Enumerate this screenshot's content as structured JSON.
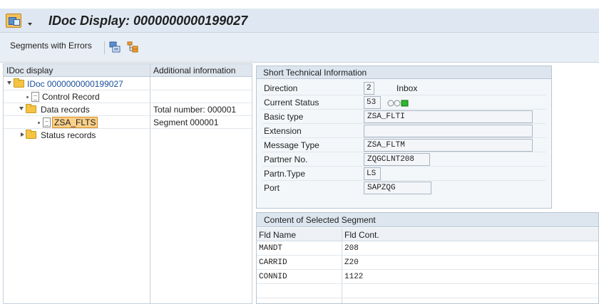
{
  "window": {
    "title": "IDoc Display: 0000000000199027"
  },
  "toolbar": {
    "segments_with_errors_label": "Segments with Errors",
    "icon1": "structure-display-icon",
    "icon2": "hierarchy-icon"
  },
  "tree": {
    "col_headers": [
      "IDoc display",
      "Additional information"
    ],
    "items": [
      {
        "label": "IDoc 0000000000199027",
        "info": "",
        "icon": "folder-open-icon",
        "expanded": true
      },
      {
        "label": "Control Record",
        "info": "",
        "icon": "document-icon"
      },
      {
        "label": "Data records",
        "info": "Total number: 000001",
        "icon": "folder-open-icon",
        "expanded": true
      },
      {
        "label": "ZSA_FLTS",
        "info": "Segment 000001",
        "icon": "document-icon",
        "selected": true
      },
      {
        "label": "Status records",
        "info": "",
        "icon": "folder-closed-icon",
        "expanded": false
      }
    ]
  },
  "technical_info": {
    "title": "Short Technical Information",
    "fields": [
      {
        "label": "Direction",
        "value": "2",
        "extra": "Inbox"
      },
      {
        "label": "Current Status",
        "value": "53",
        "status_color": "green"
      },
      {
        "label": "Basic type",
        "value": "ZSA_FLTI"
      },
      {
        "label": "Extension",
        "value": ""
      },
      {
        "label": "Message Type",
        "value": "ZSA_FLTM"
      },
      {
        "label": "Partner No.",
        "value": "ZQGCLNT208"
      },
      {
        "label": "Partn.Type",
        "value": "LS"
      },
      {
        "label": "Port",
        "value": "SAPZQG"
      }
    ]
  },
  "segment_content": {
    "title": "Content of Selected Segment",
    "col_headers": [
      "Fld Name",
      "Fld Cont."
    ],
    "rows": [
      {
        "name": "MANDT",
        "value": "208"
      },
      {
        "name": "CARRID",
        "value": "Z20"
      },
      {
        "name": "CONNID",
        "value": "1122"
      },
      {
        "name": "",
        "value": ""
      }
    ]
  },
  "colors": {
    "accent_selection": "#fbd08a",
    "status_green": "#2db82d",
    "header_bg": "#dfe8f2"
  }
}
